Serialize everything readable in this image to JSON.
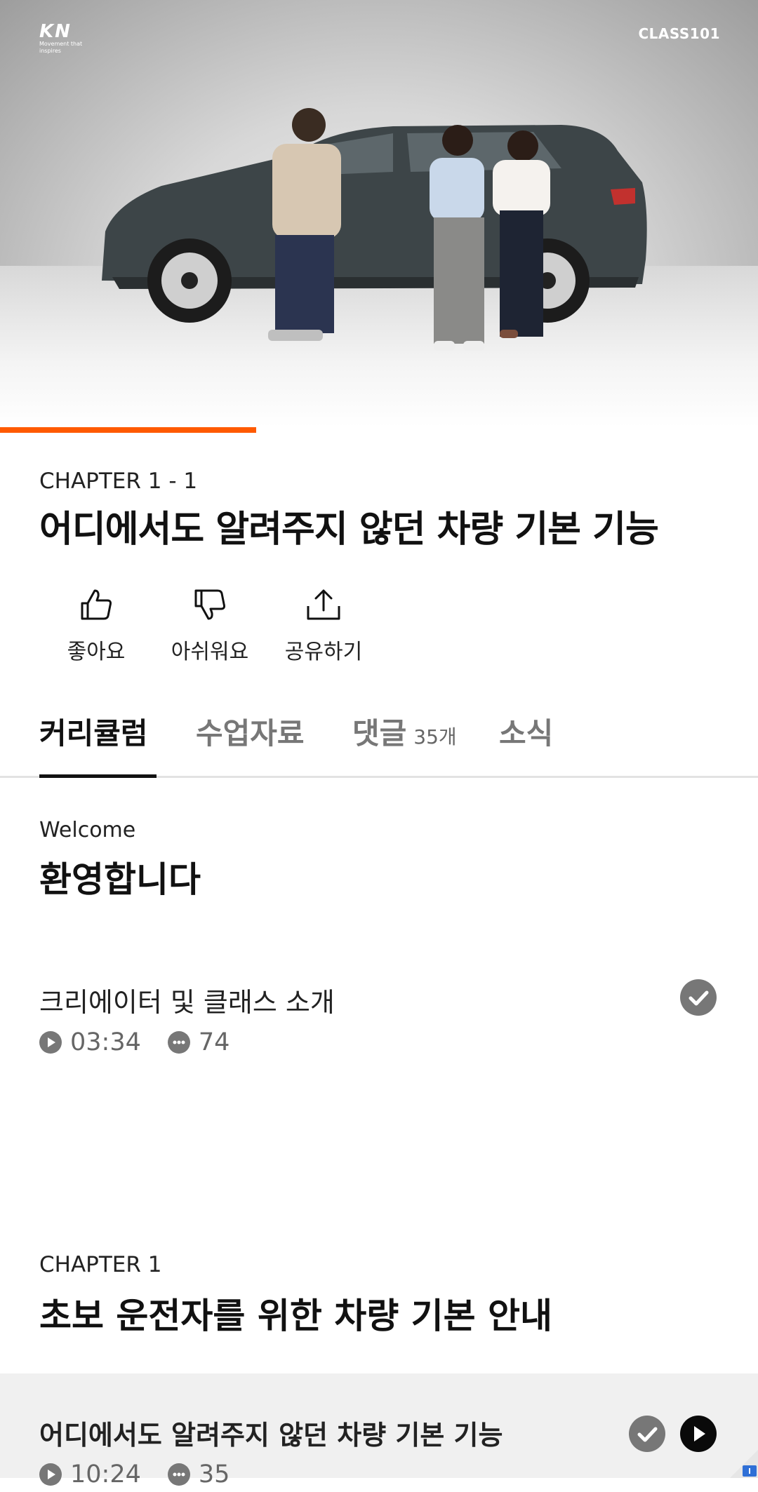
{
  "video": {
    "brand_logo": "KN",
    "brand_tagline": "Movement that inspires",
    "provider": "CLASS101",
    "progress_fraction": 0.338,
    "accent_color": "#ff5a00"
  },
  "lesson": {
    "chapter_label": "CHAPTER 1 - 1",
    "title": "어디에서도 알려주지 않던 차량 기본 기능"
  },
  "actions": [
    {
      "label": "좋아요",
      "icon": "thumbs-up-icon"
    },
    {
      "label": "아쉬워요",
      "icon": "thumbs-down-icon"
    },
    {
      "label": "공유하기",
      "icon": "share-icon"
    }
  ],
  "tabs": [
    {
      "label": "커리큘럼",
      "active": true
    },
    {
      "label": "수업자료",
      "active": false
    },
    {
      "label": "댓글",
      "count": "35개",
      "active": false
    },
    {
      "label": "소식",
      "active": false
    }
  ],
  "curriculum": {
    "welcome": {
      "subtitle": "Welcome",
      "title": "환영합니다",
      "lessons": [
        {
          "name": "크리에이터 및 클래스 소개",
          "duration": "03:34",
          "comments": "74",
          "status": "completed"
        }
      ]
    },
    "chapter1": {
      "label": "CHAPTER 1",
      "title": "초보 운전자를 위한 차량 기본 안내",
      "lessons": [
        {
          "name": "어디에서도 알려주지 않던 차량 기본 기능",
          "duration": "10:24",
          "comments": "35",
          "status": "completed",
          "current": true
        }
      ]
    }
  }
}
